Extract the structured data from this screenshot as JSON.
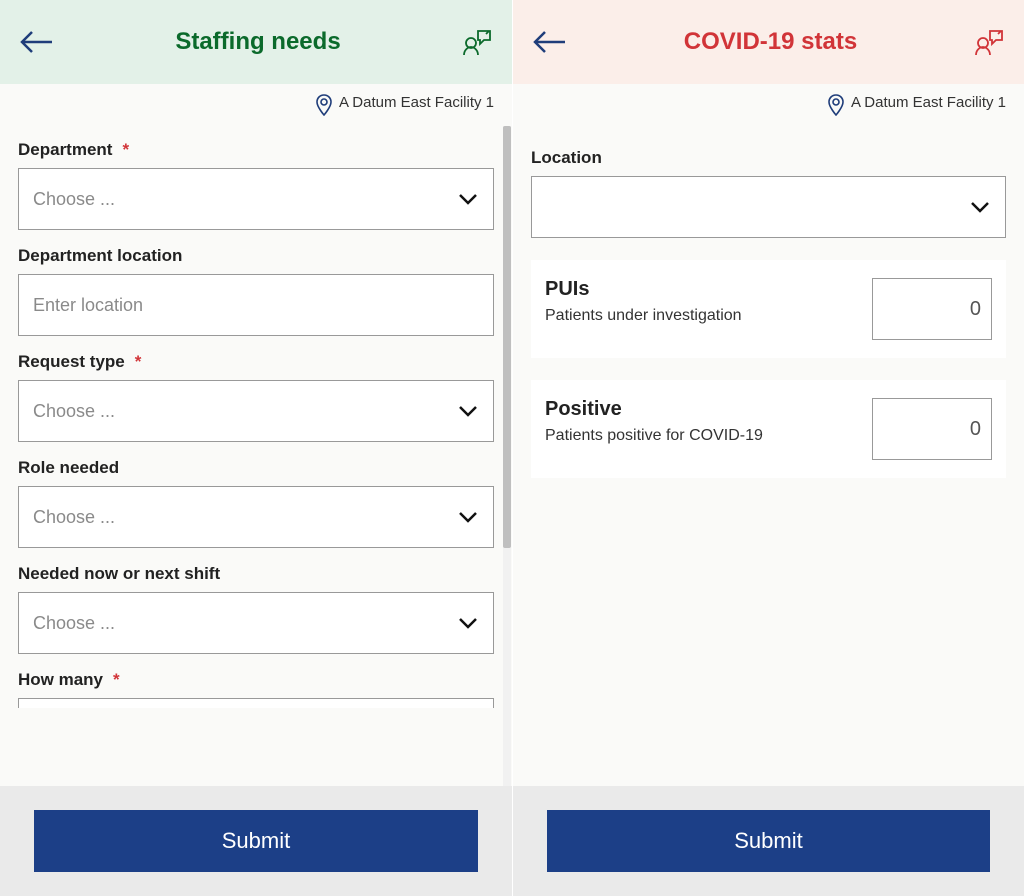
{
  "left": {
    "header": {
      "title": "Staffing needs"
    },
    "facility": "A Datum East Facility 1",
    "fields": {
      "department_label": "Department",
      "department_placeholder": "Choose ...",
      "dept_location_label": "Department location",
      "dept_location_placeholder": "Enter location",
      "request_type_label": "Request type",
      "request_type_placeholder": "Choose ...",
      "role_label": "Role needed",
      "role_placeholder": "Choose ...",
      "timing_label": "Needed now or next shift",
      "timing_placeholder": "Choose ...",
      "howmany_label": "How many"
    },
    "submit": "Submit"
  },
  "right": {
    "header": {
      "title": "COVID-19 stats"
    },
    "facility": "A Datum East Facility 1",
    "location_label": "Location",
    "puis": {
      "title": "PUIs",
      "subtitle": "Patients under investigation",
      "value": "0"
    },
    "positive": {
      "title": "Positive",
      "subtitle": "Patients positive for COVID-19",
      "value": "0"
    },
    "submit": "Submit"
  }
}
